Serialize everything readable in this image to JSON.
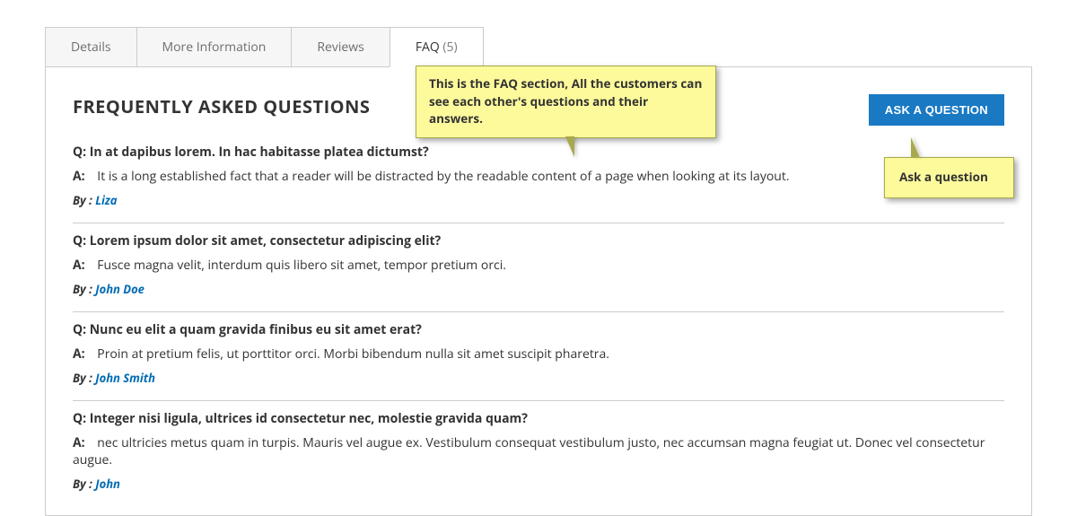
{
  "tabs": [
    {
      "label": "Details",
      "active": false
    },
    {
      "label": "More Information",
      "active": false
    },
    {
      "label": "Reviews",
      "active": false
    },
    {
      "label": "FAQ",
      "count": "(5)",
      "active": true
    }
  ],
  "panel": {
    "heading": "FREQUENTLY ASKED QUESTIONS",
    "ask_button": "ASK A QUESTION",
    "q_prefix": "Q:",
    "a_prefix": "A:",
    "by_prefix": "By :"
  },
  "callouts": {
    "faq_desc": "This is the FAQ section, All the customers can see each other's questions and their answers.",
    "ask_desc": "Ask a question"
  },
  "faqs": [
    {
      "q": "In at dapibus lorem. In hac habitasse platea dictumst?",
      "a": "It is a long established fact that a reader will be distracted by the readable content of a page when looking at its layout.",
      "by": "Liza"
    },
    {
      "q": "Lorem ipsum dolor sit amet, consectetur adipiscing elit?",
      "a": "Fusce magna velit, interdum quis libero sit amet, tempor pretium orci.",
      "by": "John Doe"
    },
    {
      "q": "Nunc eu elit a quam gravida finibus eu sit amet erat?",
      "a": "Proin at pretium felis, ut porttitor orci. Morbi bibendum nulla sit amet suscipit pharetra.",
      "by": "John Smith"
    },
    {
      "q": "Integer nisi ligula, ultrices id consectetur nec, molestie gravida quam?",
      "a": "nec ultricies metus quam in turpis. Mauris vel augue ex. Vestibulum consequat vestibulum justo, nec accumsan magna feugiat ut. Donec vel consectetur augue.",
      "by": "John"
    }
  ]
}
